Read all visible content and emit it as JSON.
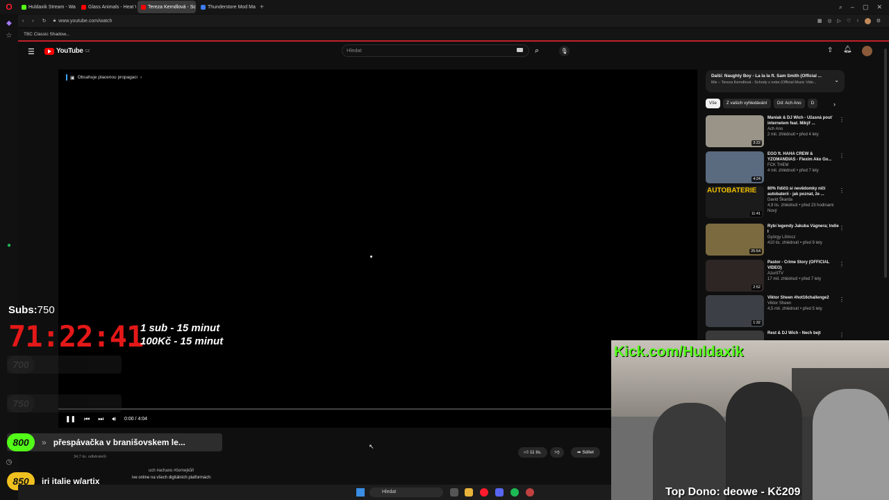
{
  "browser": {
    "tabs": [
      {
        "label": "Huldaxik Stream - Wa",
        "color": "#53fc18"
      },
      {
        "label": "Glass Animals - Heat Wa",
        "color": "#ff0000"
      },
      {
        "label": "Tereza Kerndlová - Schod",
        "color": "#ff0000",
        "active": true
      },
      {
        "label": "Thunderstore Mod Mana",
        "color": "#3d7cf0"
      }
    ],
    "new_tab": "+",
    "url": "www.youtube.com/watch",
    "bookmark": "TBC Classic Shadow..."
  },
  "youtube": {
    "logo_text": "YouTube",
    "region": "CZ",
    "search_placeholder": "Hledat"
  },
  "video": {
    "promo_text": "Obsahuje placenou propagaci",
    "time": "0:00 / 4:04"
  },
  "actions": {
    "likes": "11 tis.",
    "share": "Sdílet",
    "hashtags": "uch #achano #černejkůň",
    "description": "ive online na všech digitálních platformách:",
    "subscribers": "34,7 tis. odběratelů"
  },
  "sidebar": {
    "up_next_title": "Další: Naughty Boy - La la la ft. Sam Smith (Official ...",
    "up_next_sub": "Mix – Tereza Kerndlová - Schody z nebe (Official Music Vide...",
    "chips": [
      "Vše",
      "Z vašich vyhledávání",
      "Od: Ach Ano",
      "D"
    ],
    "recs": [
      {
        "title": "Maniak & DJ Wich - Úžasná pouť internetem feat. Mikýř ...",
        "channel": "Ach Ano",
        "meta": "2 mil. zhlédnutí • před 4 lety",
        "dur": "3:22",
        "color": "#9a9488"
      },
      {
        "title": "EGO ft. HAHA CREW & YZOMANDIAS - Flexim Ako Go...",
        "channel": "FCK THEM",
        "meta": "4 mil. zhlédnutí • před 7 lety",
        "dur": "4:24",
        "color": "#5a6b80"
      },
      {
        "title": "80% řidičů si nevědomky ničí autobaterii - jak poznat, že ...",
        "channel": "David Škarda",
        "meta": "4,9 tis. zhlédnutí • před 23 hodinami",
        "extra": "Nový",
        "dur": "11:41",
        "color": "#1b1b1b",
        "thumb_text": "AUTOBATERIE"
      },
      {
        "title": "Rybí legendy Jakuba Vágnera; Indie I",
        "channel": "György Lőrincz",
        "meta": "410 tis. zhlédnutí • před 9 lety",
        "dur": "25:54",
        "color": "#7b6a40"
      },
      {
        "title": "Pastor - Crime Story (OFFICIAL VIDEO)",
        "channel": "AzuritTV",
        "meta": "17 mil. zhlédnutí • před 7 lety",
        "dur": "2:52",
        "color": "#2d2625"
      },
      {
        "title": "Viktor Sheen #hot16challenge2",
        "channel": "Viktor Sheen",
        "meta": "4,5 mil. zhlédnutí • před 5 lety",
        "dur": "1:32",
        "color": "#3c3f45"
      },
      {
        "title": "Rest & DJ Wich - Nech bejt",
        "channel": "",
        "meta": "",
        "dur": "",
        "color": "#3a3a3a"
      }
    ]
  },
  "overlay": {
    "subs_label": "Subs:",
    "subs_value": "750",
    "timer": "71:22:41",
    "rule1": "1 sub - 15 minut",
    "rule2": "100Kč - 15 minut",
    "goals": [
      {
        "num": "700",
        "text": "",
        "color": "#3a3a3a",
        "dim": true
      },
      {
        "num": "750",
        "text": "",
        "color": "#3a3a3a",
        "dim": true
      },
      {
        "num": "800",
        "text": "přespávačka v branišovskem le...",
        "color": "#53fc18"
      },
      {
        "num": "850",
        "text": "iri italie w/artix",
        "color": "#f0c020"
      }
    ],
    "kick_text": "Kick.com/Huldaxik",
    "top_dono": "Top Dono: deowe - Kč209"
  },
  "taskbar": {
    "search": "Hledat"
  },
  "colors": {
    "accent_red": "#ff0000",
    "kick_green": "#53fc18",
    "timer_red": "#e41818"
  }
}
